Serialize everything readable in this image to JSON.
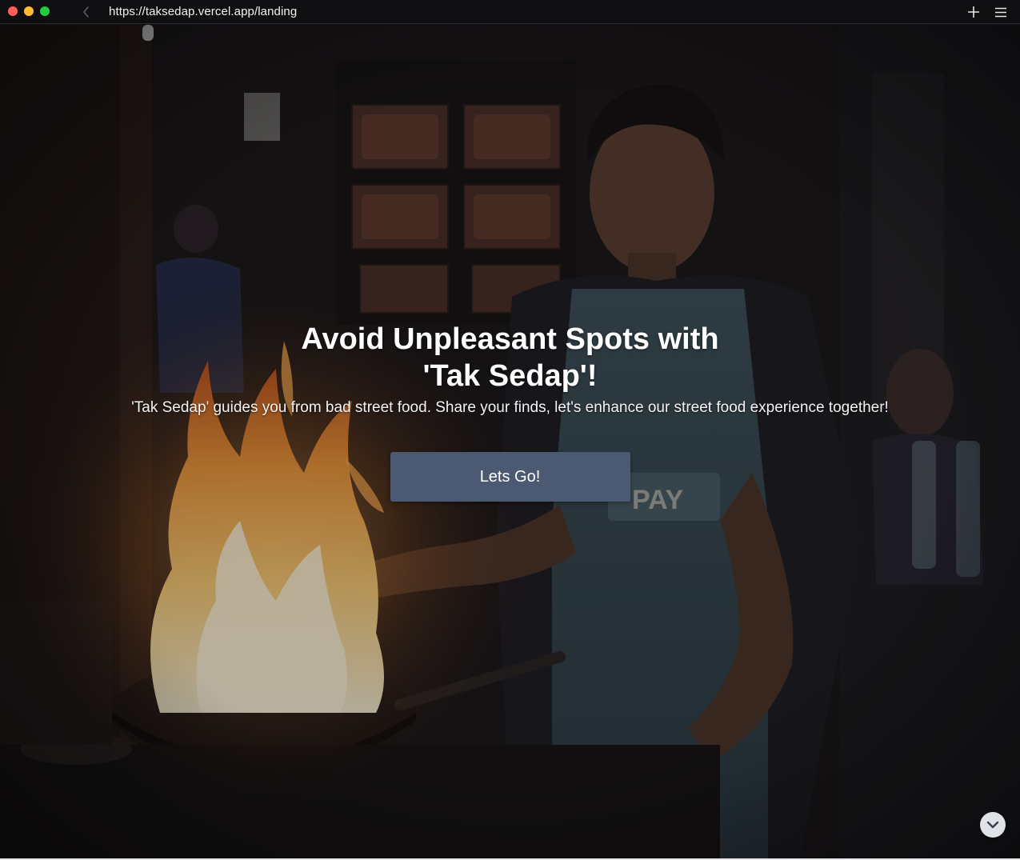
{
  "browser": {
    "url": "https://taksedap.vercel.app/landing",
    "window_buttons": [
      "close",
      "minimize",
      "maximize"
    ],
    "icons": {
      "back": "chevron-left-icon",
      "new_tab": "plus-icon",
      "menu": "hamburger-menu-icon"
    }
  },
  "hero": {
    "title": "Avoid Unpleasant Spots with 'Tak Sedap'!",
    "subtitle": "'Tak Sedap' guides you from bad street food. Share your finds, let's enhance our street food experience together!",
    "cta_label": "Lets Go!",
    "scroll_icon": "chevron-down-icon",
    "background_image": "street food vendor cooking with flaming wok at night stall"
  },
  "colors": {
    "cta_background": "#4b5973",
    "text": "#ffffff",
    "chrome_background": "#0f0f12"
  }
}
